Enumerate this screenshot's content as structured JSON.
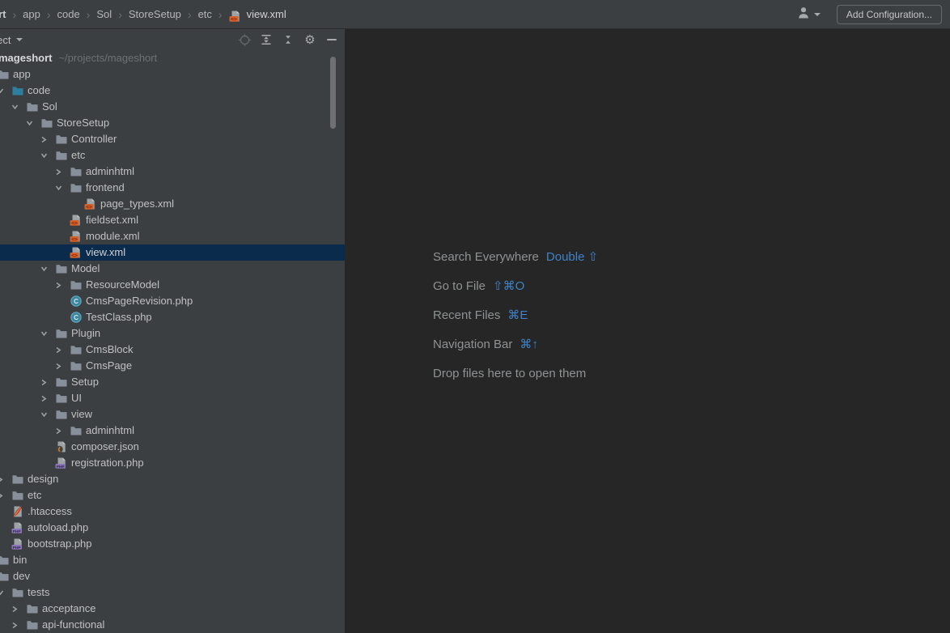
{
  "topbar": {
    "breadcrumbs": [
      "mageshort",
      "app",
      "code",
      "Sol",
      "StoreSetup",
      "etc",
      "view.xml"
    ],
    "breadcrumb_separator": "›",
    "icons": [
      "user-icon",
      "dropdown-caret-icon"
    ],
    "add_configuration_label": "Add Configuration..."
  },
  "project_panel": {
    "title": "Project",
    "toolbar_icons": [
      "locate-icon",
      "expand-all-icon",
      "collapse-all-icon",
      "settings-gear-icon",
      "hide-panel-icon"
    ],
    "root_label": "mageshort",
    "root_path": "~/projects/mageshort"
  },
  "tree": {
    "rows": [
      {
        "label": "mageshort",
        "path": "~/projects/mageshort",
        "level": 0,
        "icon": "folder",
        "chevron": "down",
        "bold": true
      },
      {
        "label": "app",
        "level": 1,
        "icon": "folder",
        "chevron": "down"
      },
      {
        "label": "code",
        "level": 2,
        "icon": "folder-source",
        "chevron": "down"
      },
      {
        "label": "Sol",
        "level": 3,
        "icon": "folder",
        "chevron": "down"
      },
      {
        "label": "StoreSetup",
        "level": 4,
        "icon": "folder",
        "chevron": "down"
      },
      {
        "label": "Controller",
        "level": 5,
        "icon": "folder",
        "chevron": "right"
      },
      {
        "label": "etc",
        "level": 5,
        "icon": "folder",
        "chevron": "down"
      },
      {
        "label": "adminhtml",
        "level": 6,
        "icon": "folder",
        "chevron": "right"
      },
      {
        "label": "frontend",
        "level": 6,
        "icon": "folder",
        "chevron": "down"
      },
      {
        "label": "page_types.xml",
        "level": 7,
        "icon": "xml-file"
      },
      {
        "label": "fieldset.xml",
        "level": 6,
        "icon": "xml-file"
      },
      {
        "label": "module.xml",
        "level": 6,
        "icon": "xml-file"
      },
      {
        "label": "view.xml",
        "level": 6,
        "icon": "xml-file",
        "selected": true
      },
      {
        "label": "Model",
        "level": 5,
        "icon": "folder",
        "chevron": "down"
      },
      {
        "label": "ResourceModel",
        "level": 6,
        "icon": "folder",
        "chevron": "right"
      },
      {
        "label": "CmsPageRevision.php",
        "level": 6,
        "icon": "php-class"
      },
      {
        "label": "TestClass.php",
        "level": 6,
        "icon": "php-class"
      },
      {
        "label": "Plugin",
        "level": 5,
        "icon": "folder",
        "chevron": "down"
      },
      {
        "label": "CmsBlock",
        "level": 6,
        "icon": "folder",
        "chevron": "right"
      },
      {
        "label": "CmsPage",
        "level": 6,
        "icon": "folder",
        "chevron": "right"
      },
      {
        "label": "Setup",
        "level": 5,
        "icon": "folder",
        "chevron": "right"
      },
      {
        "label": "UI",
        "level": 5,
        "icon": "folder",
        "chevron": "right"
      },
      {
        "label": "view",
        "level": 5,
        "icon": "folder",
        "chevron": "down"
      },
      {
        "label": "adminhtml",
        "level": 6,
        "icon": "folder",
        "chevron": "right"
      },
      {
        "label": "composer.json",
        "level": 5,
        "icon": "json-file"
      },
      {
        "label": "registration.php",
        "level": 5,
        "icon": "php-file"
      },
      {
        "label": "design",
        "level": 2,
        "icon": "folder",
        "chevron": "right"
      },
      {
        "label": "etc",
        "level": 2,
        "icon": "folder",
        "chevron": "right"
      },
      {
        "label": ".htaccess",
        "level": 2,
        "icon": "htaccess-file"
      },
      {
        "label": "autoload.php",
        "level": 2,
        "icon": "php-file"
      },
      {
        "label": "bootstrap.php",
        "level": 2,
        "icon": "php-file"
      },
      {
        "label": "bin",
        "level": 1,
        "icon": "folder",
        "chevron": "right"
      },
      {
        "label": "dev",
        "level": 1,
        "icon": "folder",
        "chevron": "down"
      },
      {
        "label": "tests",
        "level": 2,
        "icon": "folder",
        "chevron": "down"
      },
      {
        "label": "acceptance",
        "level": 3,
        "icon": "folder",
        "chevron": "right"
      },
      {
        "label": "api-functional",
        "level": 3,
        "icon": "folder",
        "chevron": "right"
      }
    ]
  },
  "editor": {
    "shortcuts": [
      {
        "label": "Search Everywhere",
        "keys": "Double ⇧"
      },
      {
        "label": "Go to File",
        "keys": "⇧⌘O"
      },
      {
        "label": "Recent Files",
        "keys": "⌘E"
      },
      {
        "label": "Navigation Bar",
        "keys": "⌘↑"
      },
      {
        "label": "Drop files here to open them",
        "keys": ""
      }
    ]
  },
  "colors": {
    "toolbar_bg": "#3c3f41",
    "editor_bg": "#262626",
    "selection_bg": "#0b2b4c",
    "accent_blue": "#3f82c7",
    "tree_text": "#bfc1c3",
    "dim_text": "#6c7174",
    "folder": "#87909a",
    "source_folder": "#2e7f9f",
    "xml_badge_orange": "#d2622a",
    "php_purple": "#8d74b8",
    "class_circle_teal": "#3e86a0",
    "htaccess_feather_red": "#b03a2e"
  }
}
